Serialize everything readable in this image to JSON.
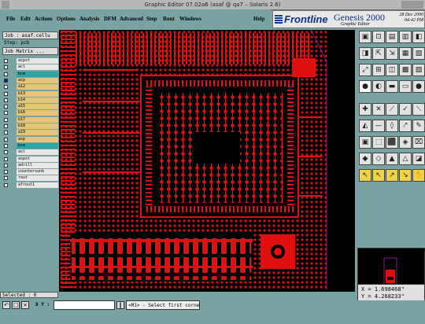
{
  "window": {
    "title": "Graphic Editor 07.02a6 (asaf @ qa7 – Solaris 2.6)"
  },
  "menu": {
    "items": [
      "File",
      "Edit",
      "Actions",
      "Options",
      "Analysis",
      "DFM",
      "Advanced",
      "Step",
      "Rout",
      "Windows"
    ],
    "help": "Help"
  },
  "logo": {
    "brand": "Frontline",
    "product": "Genesis 2000",
    "date": "28 Dec 2000",
    "time": "04:42 PM",
    "subtitle": "Graphic Editor"
  },
  "job": {
    "job_label": "Job : asaf.cellu",
    "step_label": "Step: pcb",
    "matrix_label": "Job Matrix ..."
  },
  "layers": [
    {
      "name": "acpst",
      "color": "#e8e8e8",
      "checked": false
    },
    {
      "name": "acl",
      "color": "#e8e8e8",
      "checked": false
    },
    {
      "name": "bcm",
      "color": "#2fa6a6",
      "checked": false
    },
    {
      "name": "acp",
      "color": "#e3c47a",
      "checked": true
    },
    {
      "name": "a12",
      "color": "#e3c47a",
      "checked": false
    },
    {
      "name": "b13",
      "color": "#e3c47a",
      "checked": false
    },
    {
      "name": "b14",
      "color": "#e3c47a",
      "checked": false
    },
    {
      "name": "a15",
      "color": "#e3c47a",
      "checked": false
    },
    {
      "name": "b16",
      "color": "#e3c47a",
      "checked": false
    },
    {
      "name": "b17",
      "color": "#e3c47a",
      "checked": false
    },
    {
      "name": "b18",
      "color": "#e3c47a",
      "checked": false
    },
    {
      "name": "a19",
      "color": "#e3c47a",
      "checked": false
    },
    {
      "name": "asp",
      "color": "#e3c47a",
      "checked": false
    },
    {
      "name": "bsm",
      "color": "#2fa6a6",
      "checked": false
    },
    {
      "name": "asl",
      "color": "#e8e8e8",
      "checked": false
    },
    {
      "name": "aspst",
      "color": "#e8e8e8",
      "checked": false
    },
    {
      "name": "adrill",
      "color": "#e8e8e8",
      "checked": false
    },
    {
      "name": "countersunk",
      "color": "#e8e8e8",
      "checked": false
    },
    {
      "name": "rout",
      "color": "#e8e8e8",
      "checked": false
    },
    {
      "name": "afrout1",
      "color": "#e8e8e8",
      "checked": false
    }
  ],
  "status": {
    "selected": "Selected : 0"
  },
  "coords": {
    "x": "X = 1.698468\"",
    "y": "Y = 4.268233\""
  },
  "bottom": {
    "xy_label": "X Y :",
    "message": "<M1> - Select first corner"
  },
  "icons": [
    "grid-icon",
    "pan-icon",
    "zoom-icon",
    "window-icon",
    "arrow-icon",
    "cursor-icon"
  ],
  "colors": {
    "copper": "#e01010",
    "background": "#000000",
    "panel": "#79a3a3"
  }
}
